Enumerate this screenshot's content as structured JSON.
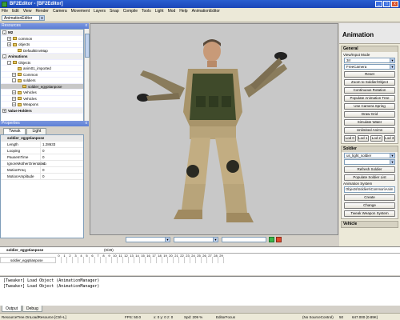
{
  "window": {
    "title": "BF2Editor - [BF2Editor]"
  },
  "menu": [
    "File",
    "Edit",
    "View",
    "Render",
    "Camera",
    "Movement",
    "Layers",
    "Snap",
    "Compile",
    "Tools",
    "Light",
    "Mod",
    "Help",
    "AnimationEditor"
  ],
  "toolbar": {
    "mode_value": "AnimationEditor"
  },
  "resources": {
    "header": "Resources",
    "items": [
      {
        "label": "M2",
        "level": 0,
        "group": true,
        "exp": "-"
      },
      {
        "label": "common",
        "level": 1,
        "exp": "+"
      },
      {
        "label": "objects",
        "level": 1,
        "exp": "+"
      },
      {
        "label": "DefaultEnvMap",
        "level": 2,
        "exp": ""
      },
      {
        "label": "Animations",
        "level": 0,
        "group": true,
        "exp": "-"
      },
      {
        "label": "Objects",
        "level": 1,
        "exp": "-"
      },
      {
        "label": "anim01_imported",
        "level": 2,
        "exp": ""
      },
      {
        "label": "Common",
        "level": 2,
        "exp": "+"
      },
      {
        "label": "soldiers",
        "level": 2,
        "exp": "-"
      },
      {
        "label": "soldier_egyptianpose",
        "level": 3,
        "exp": "",
        "selected": true
      },
      {
        "label": "Vehicles",
        "level": 2,
        "exp": "+"
      },
      {
        "label": "Vehicles",
        "level": 2,
        "exp": "+"
      },
      {
        "label": "Weapons",
        "level": 2,
        "exp": "+"
      },
      {
        "label": "Value Holders",
        "level": 0,
        "group": true,
        "exp": "+"
      }
    ]
  },
  "properties": {
    "header": "Properties",
    "tabs": [
      "Tweak",
      "Light"
    ],
    "object": "soldier_egyptianpose",
    "rows": [
      {
        "k": "Length",
        "v": "1.28633"
      },
      {
        "k": "Looping",
        "v": "0"
      },
      {
        "k": "PauseInTime",
        "v": "0"
      },
      {
        "k": "IgnoreMotherOrientation",
        "v": "-1"
      },
      {
        "k": "MotionFreq",
        "v": "0"
      },
      {
        "k": "MotionAmplitude",
        "v": "0"
      }
    ]
  },
  "right": {
    "title": "Animation",
    "general": {
      "header": "General",
      "viewinput_label": "View/Input Mode",
      "viewinput_value": "3rr",
      "camera_value": "FreeCamera",
      "buttons": [
        "Reset",
        "Zoom to Soldier/Object",
        "Continuous Rotation",
        "Populate Animation Tree",
        "Use Camera Spring",
        "Draw Grid",
        "Simulate Water",
        "Unlimited Anims"
      ],
      "lod": [
        "Lod 0",
        "Lod 1",
        "Lod 2",
        "Lod 3"
      ]
    },
    "soldier": {
      "header": "Soldier",
      "soldier_value": "us_light_soldier",
      "second_value": "",
      "refresh_label": "Refresh Soldier",
      "populate_label": "Populate Soldier List",
      "anim_system_label": "Animation System",
      "anim_system_value": "Objects\\Soldiers\\Common\\Anim",
      "create_label": "Create",
      "change_label": "Change",
      "tweak_label": "Tweak Weapon System"
    },
    "vehicle": {
      "header": "Vehicle"
    }
  },
  "timeline": {
    "name": "soldier_egyptianpose",
    "range": "(0/29)",
    "row_name": "soldier_egyptianpose",
    "frames": [
      "0",
      "1",
      "2",
      "3",
      "4",
      "5",
      "6",
      "7",
      "8",
      "9",
      "10",
      "11",
      "12",
      "13",
      "14",
      "15",
      "16",
      "17",
      "18",
      "19",
      "20",
      "21",
      "22",
      "23",
      "24",
      "25",
      "26",
      "27",
      "28",
      "29"
    ]
  },
  "console": {
    "lines": [
      "[Tweaker] Load Object (AnimationManager)",
      "[Tweaker] Load Object (AnimationManager)"
    ],
    "tabs": [
      "Output",
      "Debug"
    ]
  },
  "status": {
    "left": "ResourceTree.OnLoadResource [Ctrl+L]",
    "fps": "FPS: 50.0",
    "pos": "x: 0 y: 0 z: 0",
    "speed": "Spd: 209 %",
    "focus": "EditorFocus",
    "src": "(No SourceControl)",
    "mem1": "50",
    "mem2": "647.000 (0.89K)"
  },
  "colors": {
    "accent": "#2a5fd0",
    "viewport_bg": "#c8c8c8"
  }
}
